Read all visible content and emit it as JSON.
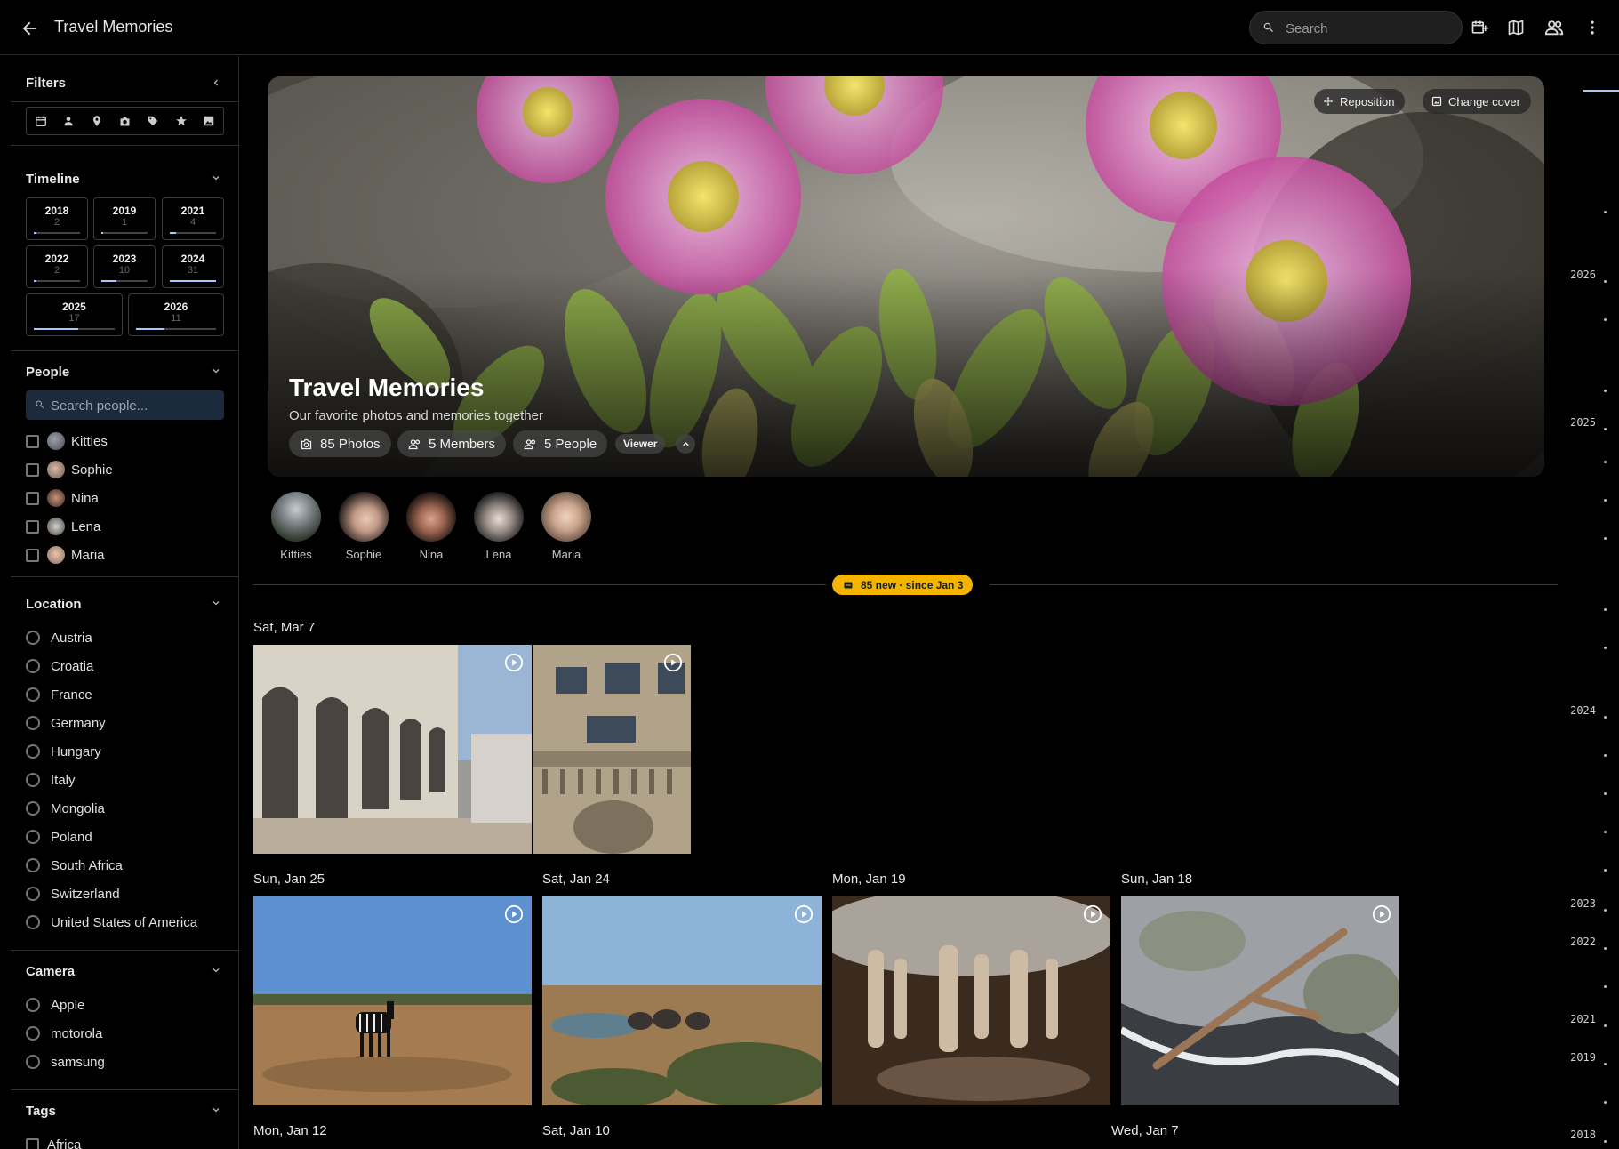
{
  "header": {
    "title": "Travel Memories",
    "search_placeholder": "Search"
  },
  "sidebar": {
    "filters_title": "Filters",
    "filter_icons": [
      "calendar-icon",
      "person-icon",
      "location-pin-icon",
      "camera-icon",
      "tag-icon",
      "star-icon",
      "image-icon"
    ],
    "timeline": {
      "title": "Timeline",
      "years": [
        {
          "year": "2018",
          "count": "2",
          "fill": 0.06
        },
        {
          "year": "2019",
          "count": "1",
          "fill": 0.03
        },
        {
          "year": "2021",
          "count": "4",
          "fill": 0.13
        },
        {
          "year": "2022",
          "count": "2",
          "fill": 0.06
        },
        {
          "year": "2023",
          "count": "10",
          "fill": 0.32
        },
        {
          "year": "2024",
          "count": "31",
          "fill": 1.0
        },
        {
          "year": "2025",
          "count": "17",
          "fill": 0.55
        },
        {
          "year": "2026",
          "count": "11",
          "fill": 0.35
        }
      ]
    },
    "people": {
      "title": "People",
      "search_placeholder": "Search people...",
      "items": [
        "Kitties",
        "Sophie",
        "Nina",
        "Lena",
        "Maria"
      ]
    },
    "location": {
      "title": "Location",
      "items": [
        "Austria",
        "Croatia",
        "France",
        "Germany",
        "Hungary",
        "Italy",
        "Mongolia",
        "Poland",
        "South Africa",
        "Switzerland",
        "United States of America"
      ]
    },
    "camera": {
      "title": "Camera",
      "items": [
        "Apple",
        "motorola",
        "samsung"
      ]
    },
    "tags": {
      "title": "Tags",
      "items": [
        "Africa"
      ]
    }
  },
  "hero": {
    "title": "Travel Memories",
    "description": "Our favorite photos and memories together",
    "reposition_label": "Reposition",
    "change_cover_label": "Change cover",
    "photos_label": "85 Photos",
    "members_label": "5 Members",
    "people_label": "5 People",
    "role_label": "Viewer"
  },
  "people_row": [
    "Kitties",
    "Sophie",
    "Nina",
    "Lena",
    "Maria"
  ],
  "new_badge": "85 new · since Jan 3",
  "groups": [
    {
      "date": "Sat, Mar 7"
    },
    {
      "date": "Sun, Jan 25"
    },
    {
      "date": "Sat, Jan 24"
    },
    {
      "date": "Mon, Jan 19"
    },
    {
      "date": "Sun, Jan 18"
    },
    {
      "date": "Mon, Jan 12"
    },
    {
      "date": "Sat, Jan 10"
    },
    {
      "date": "Wed, Jan 7"
    }
  ],
  "scrubber_years": [
    "2026",
    "2025",
    "2024",
    "2023",
    "2022",
    "2021",
    "2019",
    "2018"
  ]
}
